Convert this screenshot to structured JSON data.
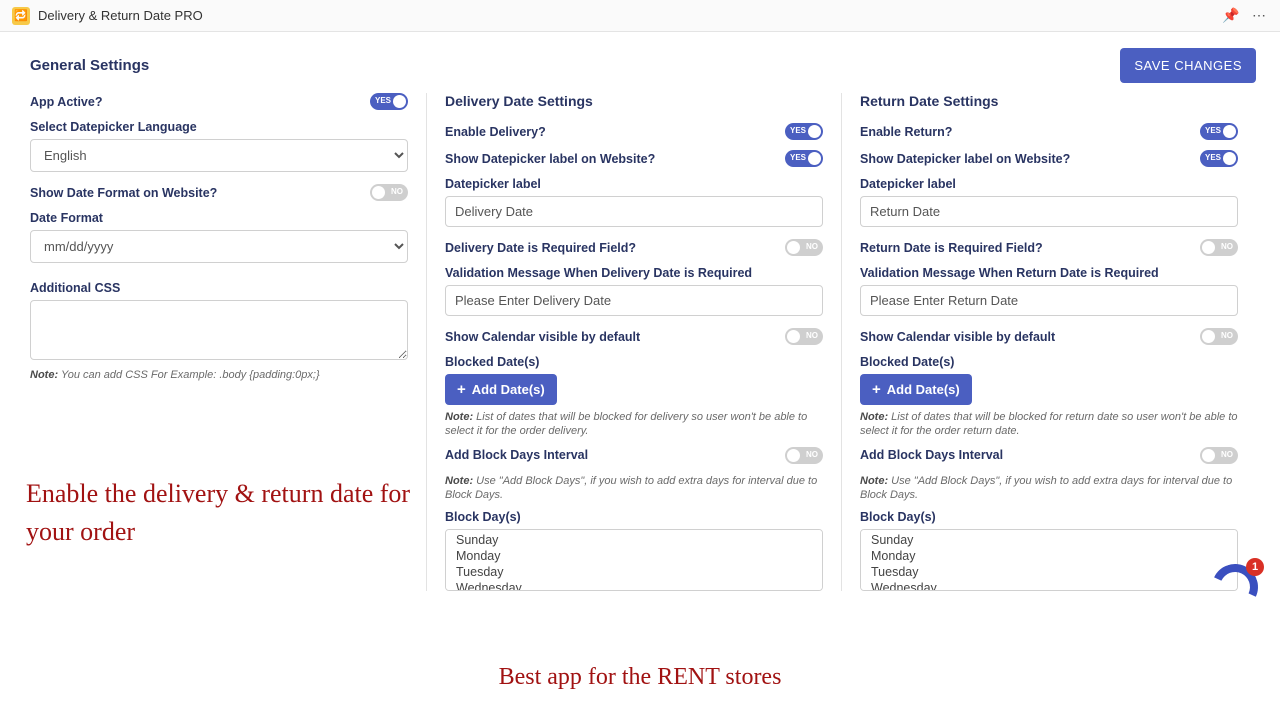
{
  "app": {
    "title": "Delivery & Return Date PRO"
  },
  "header": {
    "general": "General Settings",
    "save": "SAVE CHANGES"
  },
  "general": {
    "app_active_label": "App Active?",
    "app_active_on": "YES",
    "lang_label": "Select Datepicker Language",
    "lang_value": "English",
    "show_date_format_label": "Show Date Format on Website?",
    "show_date_format_off": "NO",
    "date_format_label": "Date Format",
    "date_format_value": "mm/dd/yyyy",
    "additional_css_label": "Additional CSS",
    "css_note_bold": "Note:",
    "css_note_text": " You can add CSS For Example: .body {padding:0px;}"
  },
  "delivery": {
    "title": "Delivery Date Settings",
    "enable_label": "Enable Delivery?",
    "enable_on": "YES",
    "show_label_label": "Show Datepicker label on Website?",
    "show_label_on": "YES",
    "dp_label_label": "Datepicker label",
    "dp_label_value": "Delivery Date",
    "required_label": "Delivery Date is Required Field?",
    "required_off": "NO",
    "validation_label": "Validation Message When Delivery Date is Required",
    "validation_value": "Please Enter Delivery Date",
    "show_cal_label": "Show Calendar visible by default",
    "show_cal_off": "NO",
    "blocked_label": "Blocked Date(s)",
    "add_dates": "Add Date(s)",
    "blocked_note_bold": "Note:",
    "blocked_note_text": " List of dates that will be blocked for delivery so user won't be able to select it for the order delivery.",
    "interval_label": "Add Block Days Interval",
    "interval_off": "NO",
    "interval_note_bold": "Note:",
    "interval_note_text": " Use \"Add Block Days\", if you wish to add extra days for interval due to Block Days.",
    "block_days_label": "Block Day(s)",
    "days": [
      "Sunday",
      "Monday",
      "Tuesday",
      "Wednesday"
    ]
  },
  "return": {
    "title": "Return Date Settings",
    "enable_label": "Enable Return?",
    "enable_on": "YES",
    "show_label_label": "Show Datepicker label on Website?",
    "show_label_on": "YES",
    "dp_label_label": "Datepicker label",
    "dp_label_value": "Return Date",
    "required_label": "Return Date is Required Field?",
    "required_off": "NO",
    "validation_label": "Validation Message When Return Date is Required",
    "validation_value": "Please Enter Return Date",
    "show_cal_label": "Show Calendar visible by default",
    "show_cal_off": "NO",
    "blocked_label": "Blocked Date(s)",
    "add_dates": "Add Date(s)",
    "blocked_note_bold": "Note:",
    "blocked_note_text": " List of dates that will be blocked for return date so user won't be able to select it for the order return date.",
    "interval_label": "Add Block Days Interval",
    "interval_off": "NO",
    "interval_note_bold": "Note:",
    "interval_note_text": " Use \"Add Block Days\", if you wish to add extra days for interval due to Block Days.",
    "block_days_label": "Block Day(s)",
    "days": [
      "Sunday",
      "Monday",
      "Tuesday",
      "Wednesday"
    ]
  },
  "promo": {
    "line1": "Enable the delivery & return date for your order",
    "line2": "Best app for the RENT stores"
  },
  "chat": {
    "badge": "1"
  }
}
